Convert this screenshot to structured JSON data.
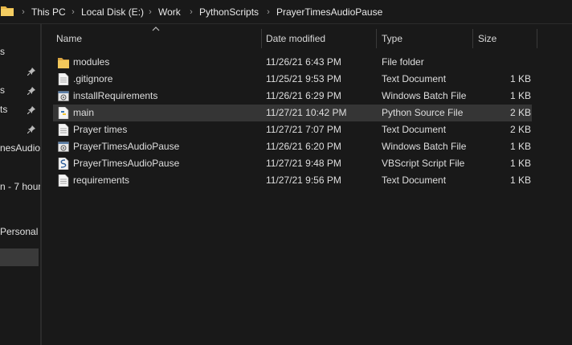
{
  "breadcrumb": [
    "This PC",
    "Local Disk (E:)",
    "Work",
    "PythonScripts",
    "PrayerTimesAudioPause"
  ],
  "nav": {
    "items": [
      {
        "label": "s"
      },
      {
        "label": "s"
      },
      {
        "label": "ts"
      },
      {
        "label": "nesAudioP"
      },
      {
        "label": "n - 7 hour"
      },
      {
        "label": "Personal"
      }
    ]
  },
  "columns": {
    "name": "Name",
    "date": "Date modified",
    "type": "Type",
    "size": "Size"
  },
  "files": [
    {
      "name": "modules",
      "date": "11/26/21 6:43 PM",
      "type": "File folder",
      "size": "",
      "icon": "folder-icon"
    },
    {
      "name": ".gitignore",
      "date": "11/25/21 9:53 PM",
      "type": "Text Document",
      "size": "1 KB",
      "icon": "text-file-icon"
    },
    {
      "name": "installRequirements",
      "date": "11/26/21 6:29 PM",
      "type": "Windows Batch File",
      "size": "1 KB",
      "icon": "batch-file-icon"
    },
    {
      "name": "main",
      "date": "11/27/21 10:42 PM",
      "type": "Python Source File",
      "size": "2 KB",
      "icon": "python-file-icon"
    },
    {
      "name": "Prayer times",
      "date": "11/27/21 7:07 PM",
      "type": "Text Document",
      "size": "2 KB",
      "icon": "text-file-icon"
    },
    {
      "name": "PrayerTimesAudioPause",
      "date": "11/26/21 6:20 PM",
      "type": "Windows Batch File",
      "size": "1 KB",
      "icon": "batch-file-icon"
    },
    {
      "name": "PrayerTimesAudioPause",
      "date": "11/27/21 9:48 PM",
      "type": "VBScript Script File",
      "size": "1 KB",
      "icon": "vbscript-file-icon"
    },
    {
      "name": "requirements",
      "date": "11/27/21 9:56 PM",
      "type": "Text Document",
      "size": "1 KB",
      "icon": "text-file-icon"
    }
  ]
}
